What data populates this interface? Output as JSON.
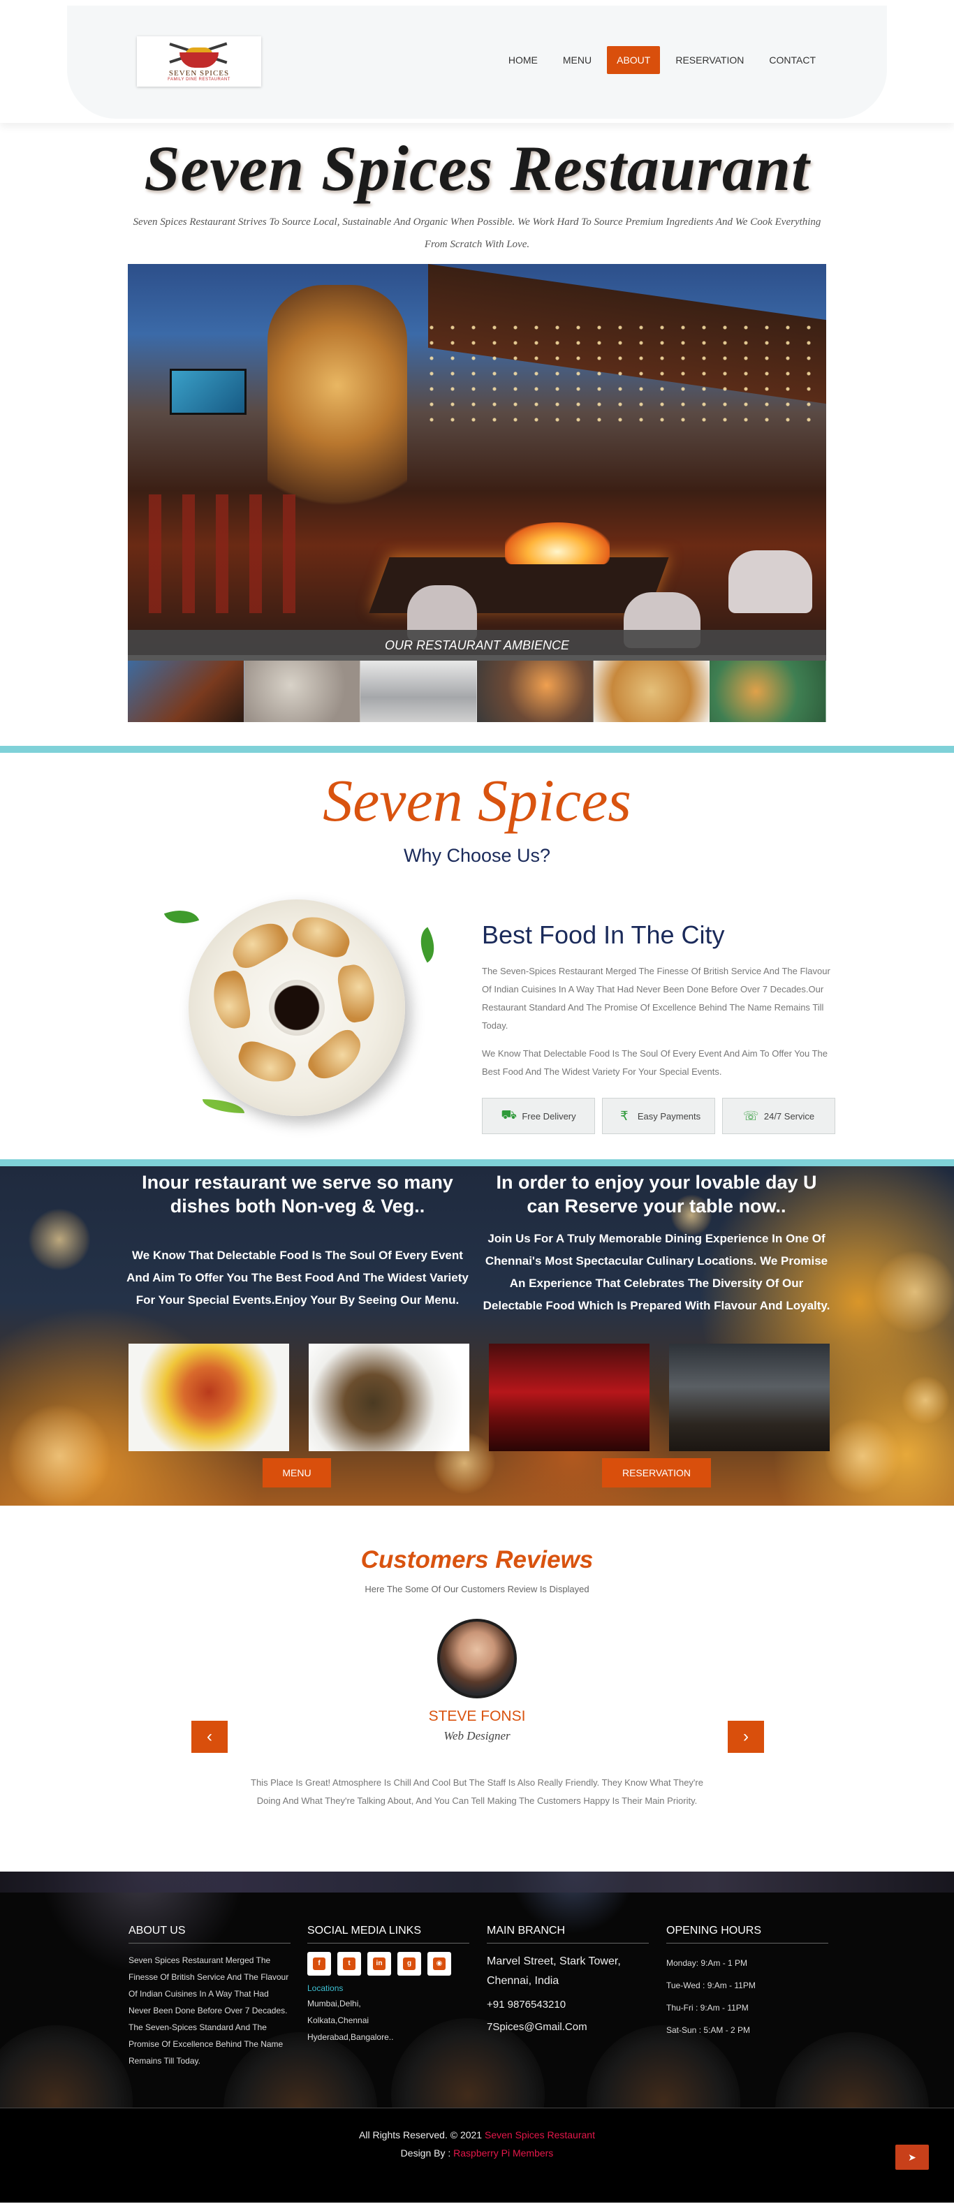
{
  "brand": {
    "logo_name": "SEVEN SPICES",
    "logo_tagline": "FAMILY DINE RESTAURANT"
  },
  "nav": {
    "items": [
      {
        "label": "HOME"
      },
      {
        "label": "MENU"
      },
      {
        "label": "ABOUT"
      },
      {
        "label": "RESERVATION"
      },
      {
        "label": "CONTACT"
      }
    ],
    "active": "ABOUT"
  },
  "hero": {
    "title": "Seven Spices Restaurant",
    "subtitle": "Seven Spices Restaurant Strives To Source Local, Sustainable And Organic When Possible. We Work Hard To Source Premium Ingredients And We Cook Everything From Scratch With Love.",
    "caption": "OUR RESTAURANT AMBIENCE"
  },
  "about": {
    "title": "Seven Spices",
    "subtitle": "Why Choose Us?",
    "heading": "Best Food In The City",
    "para1": "The Seven-Spices Restaurant Merged The Finesse Of British Service And The Flavour Of Indian Cuisines In A Way That Had Never Been Done Before Over 7 Decades.Our Restaurant Standard And The Promise Of Excellence Behind The Name Remains Till Today.",
    "para2": "We Know That Delectable Food Is The Soul Of Every Event And Aim To Offer You The Best Food And The Widest Variety For Your Special Events.",
    "features": [
      {
        "label": "Free Delivery",
        "icon": "truck-icon"
      },
      {
        "label": "Easy Payments",
        "icon": "rupee-icon"
      },
      {
        "label": "24/7 Service",
        "icon": "headset-icon"
      }
    ]
  },
  "promo": {
    "left_heading": "Inour restaurant we serve so many dishes both Non-veg & Veg..",
    "left_body": "We Know That Delectable Food Is The Soul Of Every Event And Aim To Offer You The Best Food And The Widest Variety For Your Special Events.Enjoy Your By Seeing Our Menu.",
    "right_heading": "In order to enjoy your lovable day U can Reserve your table now..",
    "right_body": "Join Us For A Truly Memorable Dining Experience In One Of Chennai's Most Spectacular Culinary Locations. We Promise An Experience That Celebrates The Diversity Of Our Delectable Food Which Is Prepared With Flavour And Loyalty.",
    "menu_button": "MENU",
    "reservation_button": "RESERVATION"
  },
  "reviews": {
    "title": "Customers Reviews",
    "subtitle": "Here The Some Of Our Customers Review Is Displayed",
    "name": "STEVE FONSI",
    "role": "Web Designer",
    "text": "This Place Is Great! Atmosphere Is Chill And Cool But The Staff Is Also Really Friendly. They Know What They're Doing And What They're Talking About, And You Can Tell Making The Customers Happy Is Their Main Priority.",
    "prev_icon": "chevron-left-icon",
    "next_icon": "chevron-right-icon"
  },
  "footer": {
    "about_head": "ABOUT US",
    "about_text": "Seven Spices Restaurant Merged The Finesse Of British Service And The Flavour Of Indian Cuisines In A Way That Had Never Been Done Before Over 7 Decades. The Seven-Spices Standard And The Promise Of Excellence Behind The Name Remains Till Today.",
    "social_head": "SOCIAL MEDIA LINKS",
    "social_icons": [
      "facebook-icon",
      "twitter-icon",
      "linkedin-icon",
      "google-plus-icon",
      "instagram-icon"
    ],
    "locations_label": "Locations",
    "locations_line1": "Mumbai,Delhi,",
    "locations_line2": "Kolkata,Chennai",
    "locations_line3": "Hyderabad,Bangalore..",
    "branch_head": "MAIN BRANCH",
    "branch_address": "Marvel Street, Stark Tower, Chennai, India",
    "branch_phone": "+91 9876543210",
    "branch_email": "7Spices@Gmail.Com",
    "hours_head": "OPENING HOURS",
    "hours": [
      {
        "text": "Monday: 9:Am - 1 PM"
      },
      {
        "text": "Tue-Wed : 9:Am - 11PM"
      },
      {
        "text": "Thu-Fri : 9:Am - 11PM"
      },
      {
        "text": "Sat-Sun : 5:AM - 2 PM"
      }
    ],
    "copyright_prefix": "All Rights Reserved. © 2021 ",
    "copyright_name": "Seven Spices Restaurant",
    "design_prefix": "Design By : ",
    "design_name": "Raspberry Pi Members"
  }
}
